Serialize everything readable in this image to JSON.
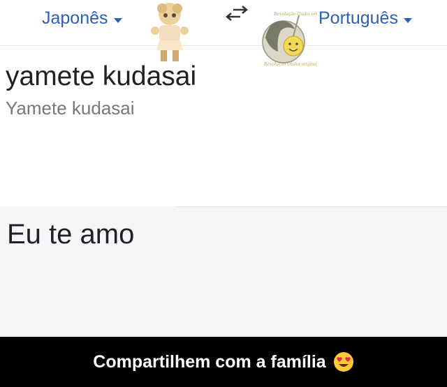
{
  "language_bar": {
    "source_language": "Japonês",
    "target_language": "Português",
    "swap_icon": "swap-arrows-icon"
  },
  "watermark": {
    "mascot": "mascot-figure",
    "badge_icon": "smiley-spartan-badge",
    "badge_text": "Revolução Otaku original"
  },
  "input": {
    "text": "yamete kudasai",
    "transliteration": "Yamete kudasai"
  },
  "output": {
    "text": "Eu te amo"
  },
  "caption": {
    "text": "Compartilhem com a família",
    "emoji": "heart-eyes-emoji"
  },
  "colors": {
    "accent": "#2f5fb3",
    "result_bg": "#f5f6f8",
    "caption_bg": "#000000"
  }
}
